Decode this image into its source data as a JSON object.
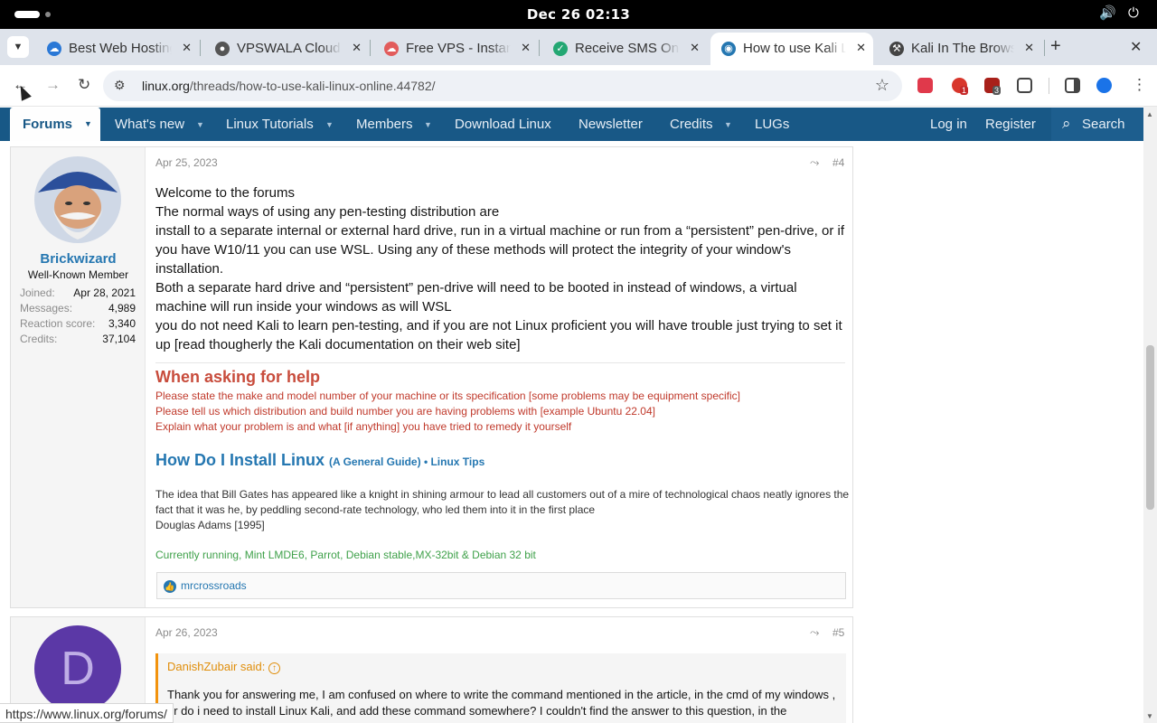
{
  "system": {
    "clock": "Dec 26  02:13",
    "volume_icon": "🔊",
    "power_icon": "⏻"
  },
  "tabs": [
    {
      "title": "Best Web Hosting",
      "favicon_color": "#2a78d6",
      "favicon": "☁"
    },
    {
      "title": "VPSWALA Cloud",
      "favicon_color": "#555",
      "favicon": "●"
    },
    {
      "title": "Free VPS - Instant",
      "favicon_color": "#e25c5c",
      "favicon": "☁"
    },
    {
      "title": "Receive SMS Online",
      "favicon_color": "#23a773",
      "favicon": "✓"
    },
    {
      "title": "How to use Kali Linux",
      "favicon_color": "#2577b1",
      "favicon": "◉"
    },
    {
      "title": "Kali In The Browser",
      "favicon_color": "#444",
      "favicon": "⚒"
    }
  ],
  "tab_close": "✕",
  "new_tab": "+",
  "window_close": "✕",
  "toolbar": {
    "back": "←",
    "forward": "→",
    "reload": "↻",
    "url_domain": "linux.org",
    "url_path": "/threads/how-to-use-kali-linux-online.44782/",
    "star": "☆",
    "menu": "⋮",
    "ext_badge_1": "1",
    "ext_badge_2": "3"
  },
  "nav": {
    "forums": "Forums",
    "whats_new": "What's new",
    "linux_tutorials": "Linux Tutorials",
    "members": "Members",
    "download_linux": "Download Linux",
    "newsletter": "Newsletter",
    "credits": "Credits",
    "lugs": "LUGs",
    "log_in": "Log in",
    "register": "Register",
    "search": "Search",
    "caret": "▼",
    "search_icon": "⌕"
  },
  "post4": {
    "date": "Apr 25, 2023",
    "number": "#4",
    "share_icon": "⤳",
    "author": {
      "name": "Brickwizard",
      "title": "Well-Known Member",
      "stats": [
        {
          "label": "Joined:",
          "value": "Apr 28, 2021"
        },
        {
          "label": "Messages:",
          "value": "4,989"
        },
        {
          "label": "Reaction score:",
          "value": "3,340"
        },
        {
          "label": "Credits:",
          "value": "37,104"
        }
      ]
    },
    "lines": [
      "Welcome to the forums",
      "The normal ways of using any pen-testing distribution are",
      "install to a separate internal or external hard drive, run in a virtual machine or run from a “persistent” pen-drive, or if you have W10/11 you can use WSL. Using any of these methods will protect the integrity of your window's installation.",
      "Both a separate hard drive and “persistent” pen-drive will need to be booted in instead of windows, a virtual machine will run inside your windows as will WSL",
      "you do not need Kali to learn pen-testing, and if you are not Linux proficient you will have trouble just trying to set it up [read thougherly the Kali documentation on their web site]"
    ],
    "signature": {
      "help_heading": "When asking for help",
      "help_lines": [
        "Please state the make and model number of your machine or its specification [some problems may be equipment specific]",
        "Please tell us which distribution and build number you are having problems with [example Ubuntu 22.04]",
        "Explain what your problem is and what [if anything] you have tried to remedy it yourself"
      ],
      "install_link": "How Do I Install Linux",
      "install_sub": "(A General Guide) • Linux Tips",
      "quote_text": "The idea that Bill Gates has appeared like a knight in shining armour to lead all customers out of a mire of technological chaos neatly ignores the fact that it was he, by peddling second-rate technology, who led them into it in the first place",
      "quote_author": "Douglas Adams [1995]",
      "running": "Currently running, Mint LMDE6, Parrot, Debian stable,MX-32bit & Debian 32 bit"
    },
    "reaction_user": "mrcrossroads",
    "like_icon": "👍"
  },
  "post5": {
    "date": "Apr 26, 2023",
    "number": "#5",
    "share_icon": "⤳",
    "avatar_letter": "D",
    "avatar_color": "#5b38a6",
    "quote_author": "DanishZubair said:",
    "quote_icon": "↑",
    "quote_text": "Thank you for answering me, I am confused on where to write the command mentioned in the article, in the cmd of my windows , or do i need to install Linux Kali, and add these command somewhere? I couldn't find the answer to this question, in the"
  },
  "status_url": "https://www.linux.org/forums/"
}
